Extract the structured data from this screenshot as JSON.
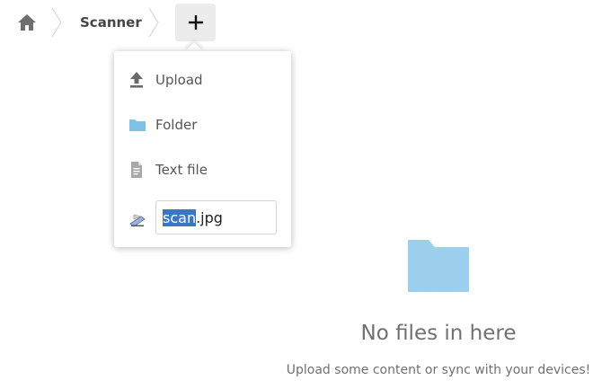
{
  "breadcrumb": {
    "home_icon": "home-icon",
    "current_folder": "Scanner"
  },
  "new_button": {
    "icon": "plus-icon"
  },
  "new_menu": {
    "items": [
      {
        "label": "Upload",
        "icon": "upload-icon"
      },
      {
        "label": "Folder",
        "icon": "folder-icon"
      },
      {
        "label": "Text file",
        "icon": "text-file-icon"
      }
    ],
    "new_file": {
      "icon": "scanner-icon",
      "selected_part": "scan",
      "rest_part": ".jpg"
    }
  },
  "empty_state": {
    "icon": "folder-icon",
    "title": "No files in here",
    "subtitle": "Upload some content or sync with your devices!"
  },
  "colors": {
    "folder": "#9dd0ef",
    "selection": "#3b76c6",
    "text": "#555555"
  }
}
